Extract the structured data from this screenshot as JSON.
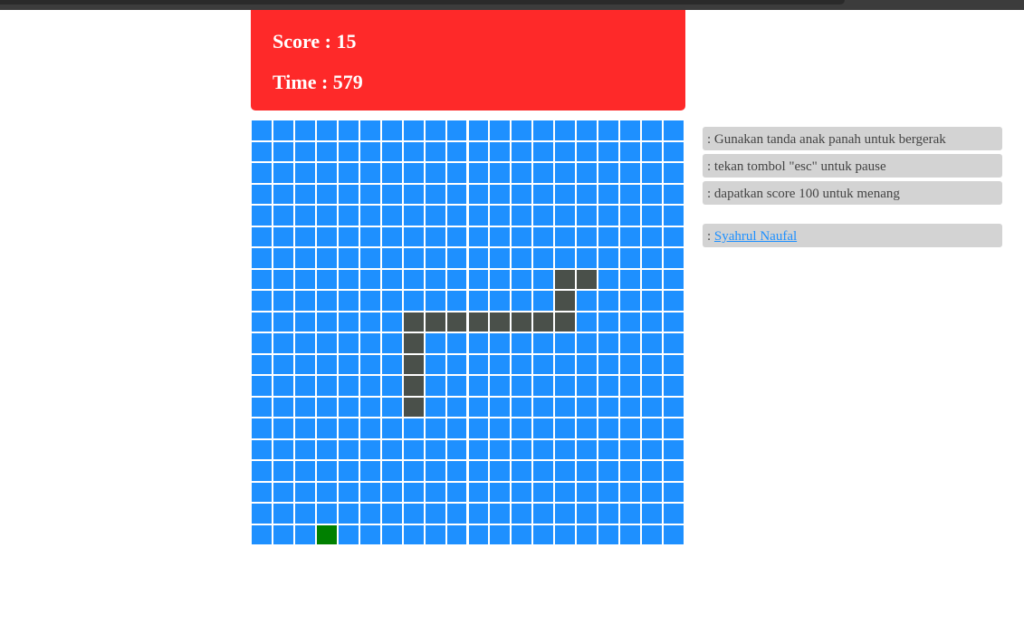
{
  "header": {
    "score_text": "Score : 15",
    "time_text": "Time : 579"
  },
  "board": {
    "cols": 20,
    "rows": 20,
    "snake": [
      [
        15,
        7
      ],
      [
        14,
        7
      ],
      [
        14,
        8
      ],
      [
        14,
        9
      ],
      [
        13,
        9
      ],
      [
        12,
        9
      ],
      [
        11,
        9
      ],
      [
        10,
        9
      ],
      [
        9,
        9
      ],
      [
        8,
        9
      ],
      [
        7,
        9
      ],
      [
        7,
        10
      ],
      [
        7,
        11
      ],
      [
        7,
        12
      ],
      [
        7,
        13
      ]
    ],
    "food": [
      3,
      19
    ],
    "cell_color": "#1e90ff",
    "snake_color": "#4a504a",
    "food_color": "#008000",
    "score": 15,
    "time": 579
  },
  "info": {
    "instructions": [
      ": Gunakan tanda anak panah untuk bergerak",
      ": tekan tombol \"esc\" untuk pause",
      ": dapatkan score 100 untuk menang"
    ],
    "author_prefix": ": ",
    "author_name": "Syahrul Naufal"
  },
  "colors": {
    "header_bg": "#fe2929",
    "info_bg": "#d3d3d3",
    "link": "#1e90ff"
  }
}
